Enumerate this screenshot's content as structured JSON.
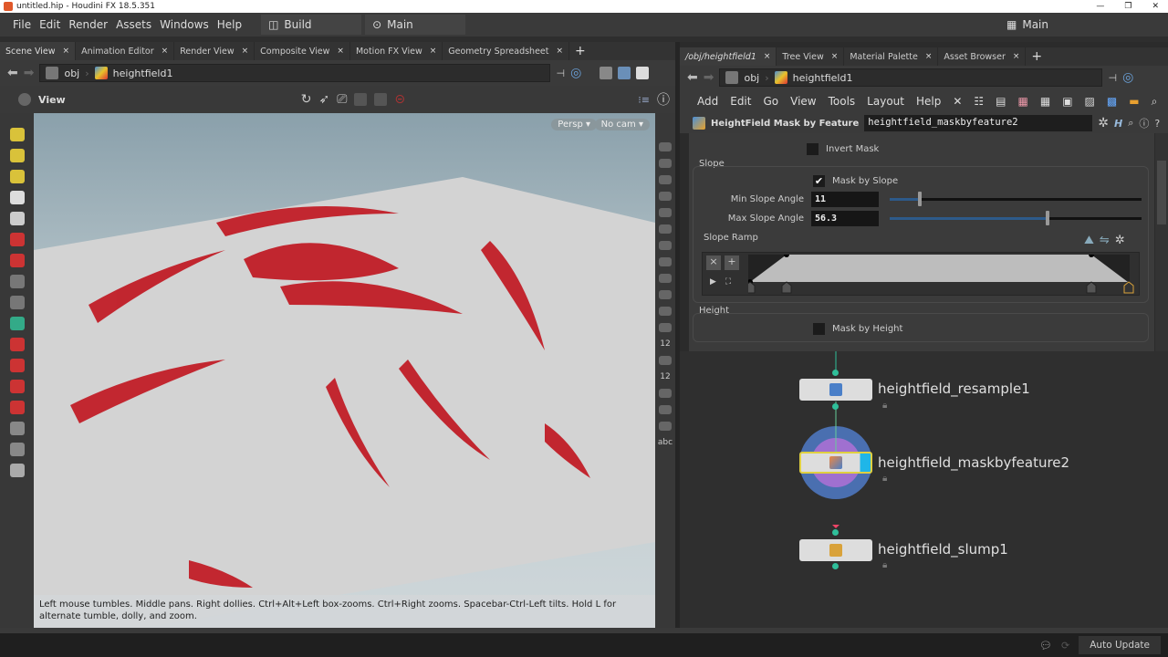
{
  "window": {
    "title": "untitled.hip - Houdini FX 18.5.351"
  },
  "menubar": {
    "items": [
      "File",
      "Edit",
      "Render",
      "Assets",
      "Windows",
      "Help"
    ],
    "desktop": "Build",
    "context": "Main",
    "right_context": "Main"
  },
  "left_pane": {
    "tabs": [
      "Scene View",
      "Animation Editor",
      "Render View",
      "Composite View",
      "Motion FX View",
      "Geometry Spreadsheet"
    ],
    "path": {
      "root": "obj",
      "node": "heightfield1"
    },
    "view_label": "View",
    "persp": "Persp ▾",
    "cam": "No cam ▾",
    "hint": "Left mouse tumbles. Middle pans. Right dollies. Ctrl+Alt+Left box-zooms. Ctrl+Right zooms. Spacebar-Ctrl-Left tilts. Hold L for alternate tumble, dolly, and zoom.",
    "right_tool_labels": [
      "12",
      "12",
      "abc"
    ]
  },
  "right_pane": {
    "tabs": [
      "/obj/heightfield1",
      "Tree View",
      "Material Palette",
      "Asset Browser"
    ],
    "path": {
      "root": "obj",
      "node": "heightfield1"
    },
    "menu": [
      "Add",
      "Edit",
      "Go",
      "View",
      "Tools",
      "Layout",
      "Help"
    ],
    "node_type": "HeightField Mask by Feature",
    "node_name": "heightfield_maskbyfeature2",
    "params": {
      "invert_mask": "Invert Mask",
      "slope_section": "Slope",
      "mask_by_slope": "Mask by Slope",
      "mask_by_slope_checked": true,
      "min_slope_label": "Min Slope Angle",
      "min_slope": "11",
      "min_slope_fraction": 0.12,
      "max_slope_label": "Max Slope Angle",
      "max_slope": "56.3",
      "max_slope_fraction": 0.625,
      "slope_ramp": "Slope Ramp",
      "height_section": "Height",
      "mask_by_height": "Mask by Height"
    },
    "nodes": [
      "heightfield_resample1",
      "heightfield_maskbyfeature2",
      "heightfield_slump1"
    ]
  },
  "statusbar": {
    "auto_update": "Auto Update"
  }
}
